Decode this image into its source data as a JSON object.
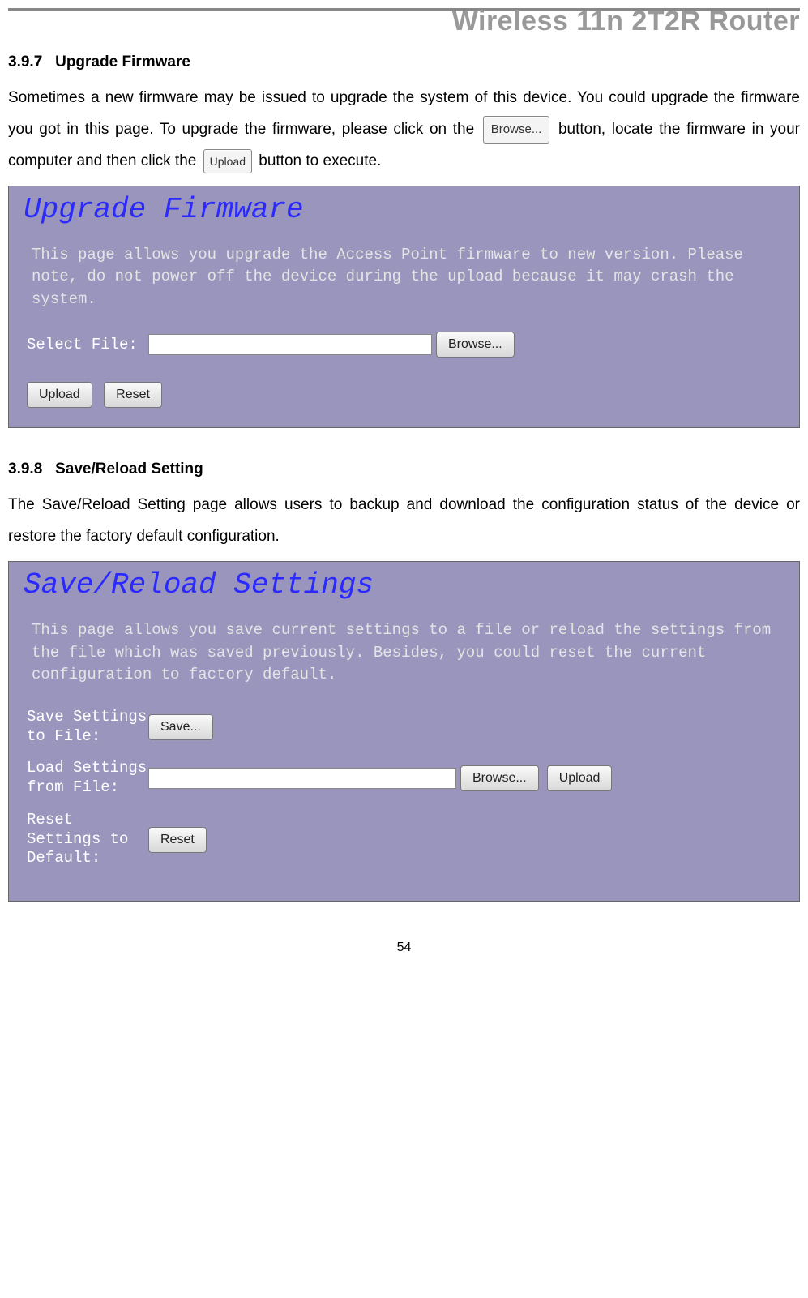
{
  "header": {
    "title": "Wireless 11n 2T2R Router"
  },
  "section1": {
    "number": "3.9.7",
    "title": "Upgrade Firmware",
    "text_part1": "Sometimes a new firmware may be issued to upgrade the system of this device. You could upgrade the firmware you got in this page. To upgrade the firmware, please click on the ",
    "btn_browse": "Browse...",
    "text_part2": " button, locate the firmware in your computer and then click the ",
    "btn_upload": "Upload",
    "text_part3": " button to execute."
  },
  "screenshot1": {
    "title": "Upgrade Firmware",
    "desc": "This page allows you upgrade the Access Point firmware to new version. Please note, do not power off the device during the upload because it may crash the system.",
    "label_select": "Select File:",
    "btn_browse": "Browse...",
    "btn_upload": "Upload",
    "btn_reset": "Reset"
  },
  "section2": {
    "number": "3.9.8",
    "title": "Save/Reload Setting",
    "text": "The Save/Reload Setting page allows users to backup and download the configuration status of the device or restore the factory default configuration."
  },
  "screenshot2": {
    "title": "Save/Reload Settings",
    "desc": "This page allows you save current settings to a file or reload the settings from the file which was saved previously. Besides, you could reset the current configuration to factory default.",
    "label_save": "Save Settings to File:",
    "btn_save": "Save...",
    "label_load": "Load Settings from File:",
    "btn_browse": "Browse...",
    "btn_upload": "Upload",
    "label_reset": "Reset Settings to Default:",
    "btn_reset": "Reset"
  },
  "footer": {
    "page": "54"
  }
}
